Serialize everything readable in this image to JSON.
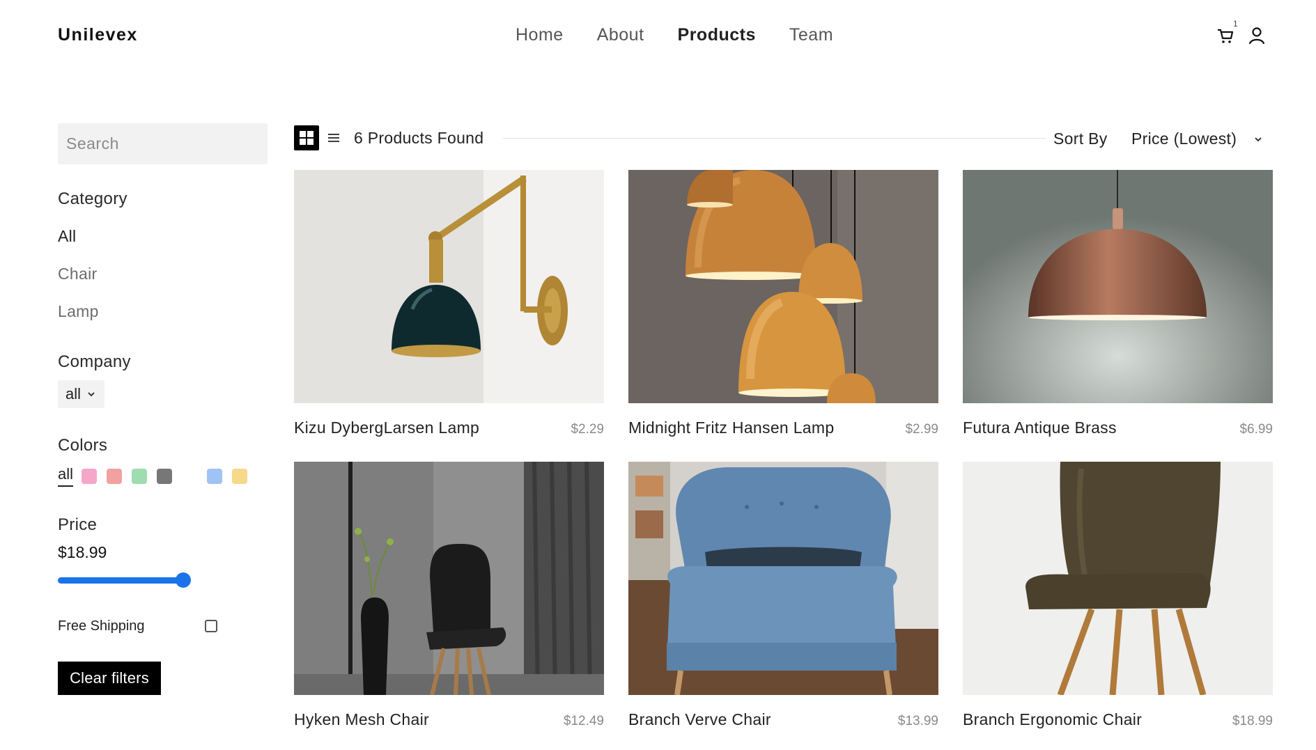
{
  "header": {
    "logo": "Unilevex",
    "nav": [
      "Home",
      "About",
      "Products",
      "Team"
    ],
    "active_nav": "Products",
    "cart_count": "1",
    "icons": [
      "cart-icon",
      "user-icon"
    ]
  },
  "sidebar": {
    "search_placeholder": "Search",
    "category_heading": "Category",
    "categories": [
      "All",
      "Chair",
      "Lamp"
    ],
    "selected_category": "All",
    "company_heading": "Company",
    "company_value": "all",
    "colors_heading": "Colors",
    "colors_all": "all",
    "colors": [
      "#f4a7c9",
      "#f2a1a1",
      "#9fdcb0",
      "#777777",
      "#ffffff",
      "#9fc3f5",
      "#f6d98a"
    ],
    "price_heading": "Price",
    "price_value": "$18.99",
    "price_level": 1.0,
    "free_shipping_label": "Free Shipping",
    "free_shipping_checked": false,
    "clear_label": "Clear filters"
  },
  "toolbar": {
    "found_text": "6 Products Found",
    "sort_label": "Sort By",
    "sort_value": "Price (Lowest)",
    "view": "grid"
  },
  "products": [
    {
      "name": "Kizu DybergLarsen Lamp",
      "price": "$2.29"
    },
    {
      "name": "Midnight Fritz Hansen Lamp",
      "price": "$2.99"
    },
    {
      "name": "Futura Antique Brass",
      "price": "$6.99"
    },
    {
      "name": "Hyken Mesh Chair",
      "price": "$12.49"
    },
    {
      "name": "Branch Verve Chair",
      "price": "$13.99"
    },
    {
      "name": "Branch Ergonomic Chair",
      "price": "$18.99"
    }
  ],
  "colors": {
    "accent": "#1a73e8",
    "button": "#000000"
  }
}
